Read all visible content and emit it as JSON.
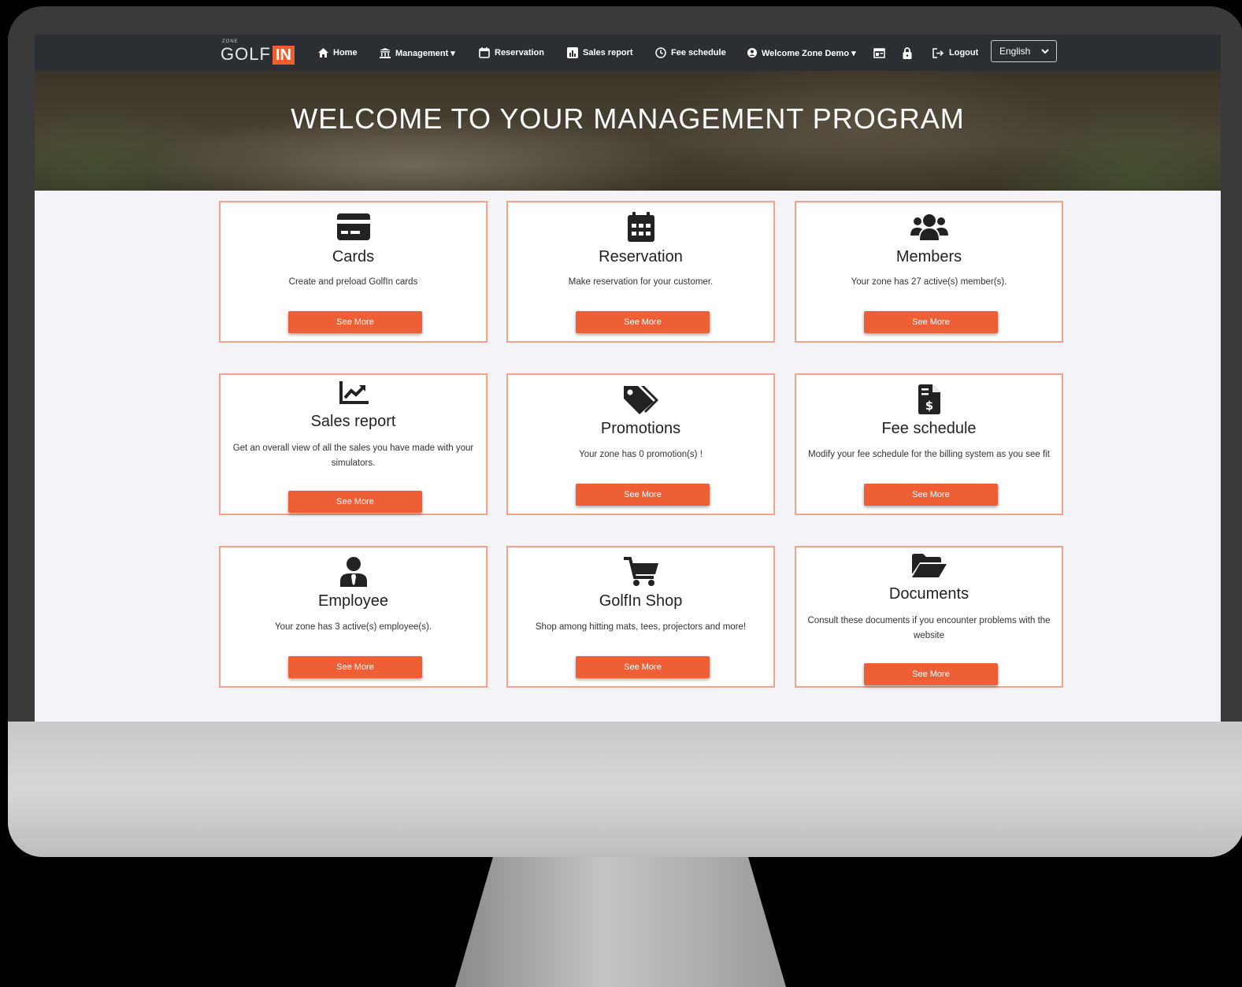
{
  "brand": {
    "zone": "ZONE",
    "golf": "GOLF",
    "in": "IN"
  },
  "nav": {
    "home": "Home",
    "management": "Management ▾",
    "reservation": "Reservation",
    "sales_report": "Sales report",
    "fee_schedule": "Fee schedule",
    "welcome": "Welcome Zone Demo ▾",
    "logout": "Logout",
    "language": "English"
  },
  "hero": {
    "title": "WELCOME TO YOUR MANAGEMENT PROGRAM"
  },
  "cards": [
    {
      "title": "Cards",
      "desc": "Create and preload GolfIn cards",
      "button": "See More",
      "icon": "credit-card-icon"
    },
    {
      "title": "Reservation",
      "desc": "Make reservation for your customer.",
      "button": "See More",
      "icon": "calendar-icon"
    },
    {
      "title": "Members",
      "desc": "Your zone has 27 active(s) member(s).",
      "button": "See More",
      "icon": "users-icon"
    },
    {
      "title": "Sales report",
      "desc": "Get an overall view of all the sales you have made with your simulators.",
      "button": "See More",
      "icon": "chart-line-icon"
    },
    {
      "title": "Promotions",
      "desc": "Your zone has 0 promotion(s) !",
      "button": "See More",
      "icon": "tags-icon"
    },
    {
      "title": "Fee schedule",
      "desc": "Modify your fee schedule for the billing system as you see fit",
      "button": "See More",
      "icon": "invoice-dollar-icon"
    },
    {
      "title": "Employee",
      "desc": "Your zone has 3 active(s) employee(s).",
      "button": "See More",
      "icon": "user-tie-icon"
    },
    {
      "title": "GolfIn Shop",
      "desc": "Shop among hitting mats, tees, projectors and more!",
      "button": "See More",
      "icon": "shopping-cart-icon"
    },
    {
      "title": "Documents",
      "desc": "Consult these documents if you encounter problems with the website",
      "button": "See More",
      "icon": "folder-open-icon"
    }
  ],
  "colors": {
    "accent": "#ef5f35",
    "card_border": "#f4a38a",
    "navbar": "#2b2f33"
  }
}
